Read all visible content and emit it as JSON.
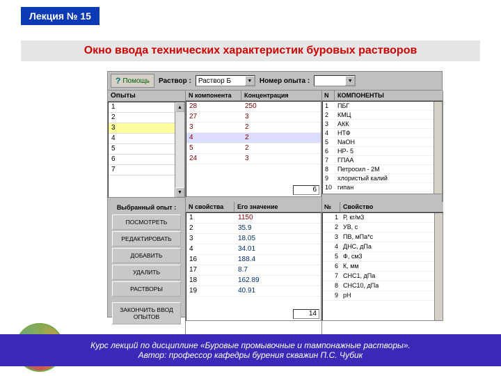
{
  "lecture_label": "Лекция № 15",
  "main_title": "Окно ввода технических характеристик буровых растворов",
  "toolbar": {
    "help": "Помощь",
    "solution_label": "Раствор :",
    "solution_value": "Раствор Б",
    "exp_no_label": "Номер опыта :"
  },
  "opyty": {
    "header": "Опыты",
    "rows": [
      "1",
      "2",
      "3",
      "4",
      "5",
      "6",
      "7"
    ]
  },
  "components_table": {
    "head_n": "N компонента",
    "head_c": "Концентрация",
    "rows": [
      {
        "n": "28",
        "c": "250"
      },
      {
        "n": "27",
        "c": "3"
      },
      {
        "n": "3",
        "c": "2"
      },
      {
        "n": "4",
        "c": "2"
      },
      {
        "n": "5",
        "c": "2"
      },
      {
        "n": "24",
        "c": "3"
      }
    ],
    "input_value": "6"
  },
  "components_list": {
    "head_n": "N",
    "head_name": "КОМПОНЕНТЫ",
    "rows": [
      {
        "n": "1",
        "name": "ПБГ"
      },
      {
        "n": "2",
        "name": "КМЦ"
      },
      {
        "n": "3",
        "name": "АКК"
      },
      {
        "n": "4",
        "name": "НТФ"
      },
      {
        "n": "5",
        "name": "NaOH"
      },
      {
        "n": "6",
        "name": "НР- 5"
      },
      {
        "n": "7",
        "name": "ГПАА"
      },
      {
        "n": "8",
        "name": "Петросил - 2М"
      },
      {
        "n": "9",
        "name": "хлористый калий"
      },
      {
        "n": "10",
        "name": "гипан"
      }
    ]
  },
  "side": {
    "label": "Выбранный опыт :",
    "buttons": [
      "ПОСМОТРЕТЬ",
      "РЕДАКТИРОВАТЬ",
      "ДОБАВИТЬ",
      "УДАЛИТЬ",
      "РАСТВОРЫ",
      "ЗАКОНЧИТЬ ВВОД ОПЫТОВ"
    ]
  },
  "props_table": {
    "head_n": "N свойства",
    "head_v": "Его значение",
    "rows": [
      {
        "n": "1",
        "v": "1150"
      },
      {
        "n": "2",
        "v": "35.9"
      },
      {
        "n": "3",
        "v": "18.05"
      },
      {
        "n": "4",
        "v": "34.01"
      },
      {
        "n": "16",
        "v": "188.4"
      },
      {
        "n": "17",
        "v": "8.7"
      },
      {
        "n": "18",
        "v": "162.89"
      },
      {
        "n": "19",
        "v": "40.91"
      }
    ],
    "input_value": "14"
  },
  "props_list": {
    "head_n": "№",
    "head_name": "Свойство",
    "rows": [
      {
        "n": "1",
        "name": "Р, кг/м3"
      },
      {
        "n": "2",
        "name": "УВ, с"
      },
      {
        "n": "3",
        "name": "ПВ, мПа*с"
      },
      {
        "n": "4",
        "name": "ДНС, дПа"
      },
      {
        "n": "5",
        "name": "Ф, см3"
      },
      {
        "n": "6",
        "name": "К, мм"
      },
      {
        "n": "7",
        "name": "СНС1, дПа"
      },
      {
        "n": "8",
        "name": "СНС10, дПа"
      },
      {
        "n": "9",
        "name": "pH"
      }
    ]
  },
  "footer": {
    "line1": "Курс лекций по дисциплине «Буровые промывочные и тампонажные растворы».",
    "line2": "Автор: профессор кафедры бурения скважин П.С. Чубик"
  }
}
